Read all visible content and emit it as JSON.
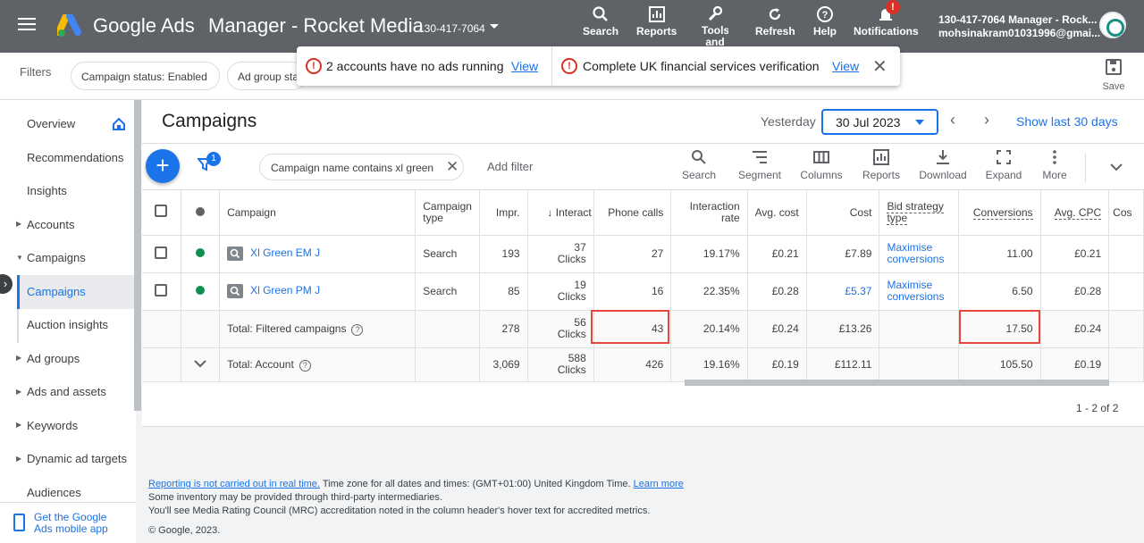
{
  "header": {
    "brand": "Google Ads",
    "account_title": "Manager - Rocket Media",
    "account_id": "130-417-7064",
    "tools": [
      {
        "label": "Search",
        "icon": "search-icon"
      },
      {
        "label": "Reports",
        "icon": "reports-icon"
      },
      {
        "label": "Tools and",
        "icon": "wrench-icon"
      },
      {
        "label": "Refresh",
        "icon": "refresh-icon"
      },
      {
        "label": "Help",
        "icon": "help-icon"
      },
      {
        "label": "Notifications",
        "icon": "bell-icon"
      }
    ],
    "notification_badge": "!",
    "user_account": "130-417-7064 Manager - Rock...",
    "user_email": "mohsinakram01031996@gmai..."
  },
  "filterbar": {
    "label": "Filters",
    "chips": [
      "Campaign status: Enabled",
      "Ad group status"
    ],
    "save_label": "Save"
  },
  "alerts": [
    {
      "text": "2 accounts have no ads running",
      "link": "View"
    },
    {
      "text": "Complete UK financial services verification",
      "link": "View"
    }
  ],
  "sidebar": {
    "items": [
      {
        "label": "Overview"
      },
      {
        "label": "Recommendations"
      },
      {
        "label": "Insights"
      },
      {
        "label": "Accounts"
      },
      {
        "label": "Campaigns"
      },
      {
        "label": "Campaigns"
      },
      {
        "label": "Auction insights"
      },
      {
        "label": "Ad groups"
      },
      {
        "label": "Ads and assets"
      },
      {
        "label": "Keywords"
      },
      {
        "label": "Dynamic ad targets"
      },
      {
        "label": "Audiences"
      }
    ],
    "mobile_app_line1": "Get the Google",
    "mobile_app_line2": "Ads mobile app"
  },
  "main": {
    "title": "Campaigns",
    "date_label": "Yesterday",
    "date_value": "30 Jul 2023",
    "show_last": "Show last 30 days",
    "filter_badge": "1",
    "filter_chip": "Campaign name contains xl green",
    "add_filter": "Add filter",
    "toolbar": [
      {
        "label": "Search",
        "icon": "search-icon"
      },
      {
        "label": "Segment",
        "icon": "segment-icon"
      },
      {
        "label": "Columns",
        "icon": "columns-icon"
      },
      {
        "label": "Reports",
        "icon": "reports-icon"
      },
      {
        "label": "Download",
        "icon": "download-icon"
      },
      {
        "label": "Expand",
        "icon": "expand-icon"
      },
      {
        "label": "More",
        "icon": "more-icon"
      }
    ]
  },
  "table": {
    "headers": {
      "campaign": "Campaign",
      "campaign_type_1": "Campaign",
      "campaign_type_2": "type",
      "impr": "Impr.",
      "interactions": "Interact",
      "phone_calls": "Phone calls",
      "interaction_rate_1": "Interaction",
      "interaction_rate_2": "rate",
      "avg_cost": "Avg. cost",
      "cost": "Cost",
      "bid_strategy_1": "Bid strategy",
      "bid_strategy_2": "type",
      "conversions": "Conversions",
      "avg_cpc": "Avg. CPC",
      "cost_more": "Cos"
    },
    "rows": [
      {
        "campaign": "Xl Green EM J",
        "type": "Search",
        "impr": "193",
        "interactions": "37",
        "interactions_unit": "Clicks",
        "phone_calls": "27",
        "interaction_rate": "19.17%",
        "avg_cost": "£0.21",
        "cost": "£7.89",
        "bid_1": "Maximise",
        "bid_2": "conversions",
        "conversions": "11.00",
        "avg_cpc": "£0.21"
      },
      {
        "campaign": "Xl Green PM J",
        "type": "Search",
        "impr": "85",
        "interactions": "19",
        "interactions_unit": "Clicks",
        "phone_calls": "16",
        "interaction_rate": "22.35%",
        "avg_cost": "£0.28",
        "cost": "£5.37",
        "bid_1": "Maximise",
        "bid_2": "conversions",
        "conversions": "6.50",
        "avg_cpc": "£0.28"
      }
    ],
    "total_filtered": {
      "label": "Total: Filtered campaigns",
      "impr": "278",
      "interactions": "56",
      "interactions_unit": "Clicks",
      "phone_calls": "43",
      "interaction_rate": "20.14%",
      "avg_cost": "£0.24",
      "cost": "£13.26",
      "conversions": "17.50",
      "avg_cpc": "£0.24"
    },
    "total_account": {
      "label": "Total: Account",
      "impr": "3,069",
      "interactions": "588",
      "interactions_unit": "Clicks",
      "phone_calls": "426",
      "interaction_rate": "19.16%",
      "avg_cost": "£0.19",
      "cost": "£112.11",
      "conversions": "105.50",
      "avg_cpc": "£0.19"
    },
    "pagination": "1 - 2 of 2"
  },
  "footer": {
    "reporting_link": "Reporting is not carried out in real time.",
    "timezone_text": " Time zone for all dates and times: (GMT+01:00) United Kingdom Time. ",
    "learn_more": "Learn more",
    "line2": "Some inventory may be provided through third-party intermediaries.",
    "line3": "You'll see Media Rating Council (MRC) accreditation noted in the column header's hover text for accredited metrics.",
    "copyright": "© Google, 2023."
  },
  "colors": {
    "topbar": "#5f6368",
    "accent": "#1a73e8",
    "enabled_dot": "#0d904f",
    "highlight": "#e8453c",
    "alert": "#d93025"
  }
}
